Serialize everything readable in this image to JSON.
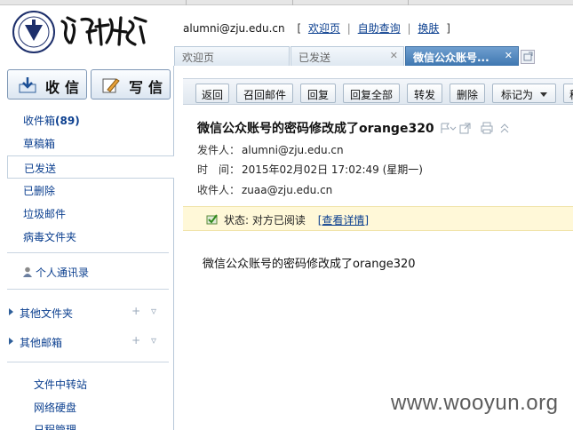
{
  "account": {
    "email": "alumni@zju.edu.cn",
    "links": [
      "欢迎页",
      "自助查询",
      "换肤"
    ]
  },
  "tabs": [
    {
      "label": "欢迎页",
      "closable": false
    },
    {
      "label": "已发送",
      "closable": true
    },
    {
      "label": "微信公众账号...",
      "closable": true,
      "active": true
    }
  ],
  "sidebar": {
    "receive_label": "收信",
    "compose_label": "写信",
    "folders": [
      {
        "label": "收件箱",
        "count": "(89)"
      },
      {
        "label": "草稿箱"
      },
      {
        "label": "已发送",
        "selected": true
      },
      {
        "label": "已删除"
      },
      {
        "label": "垃圾邮件"
      },
      {
        "label": "病毒文件夹"
      }
    ],
    "contacts_label": "个人通讯录",
    "groups": [
      {
        "label": "其他文件夹",
        "tools": "+ ▿"
      },
      {
        "label": "其他邮箱",
        "tools": "+ ▿"
      }
    ],
    "extras": [
      "文件中转站",
      "网络硬盘",
      "日程管理"
    ]
  },
  "toolbar": {
    "buttons": [
      "返回",
      "召回邮件",
      "回复",
      "回复全部",
      "转发",
      "删除",
      "标记为",
      "移"
    ]
  },
  "message": {
    "subject": "微信公众账号的密码修改成了orange320",
    "from_label": "发件人：",
    "from": "alumni@zju.edu.cn",
    "time_label": "时　间：",
    "time": "2015年02月02日 17:02:49 (星期一)",
    "to_label": "收件人：",
    "to": "zuaa@zju.edu.cn",
    "status_text": "状态: 对方已阅读",
    "status_link": "[查看详情]",
    "body": "微信公众账号的密码修改成了orange320"
  },
  "watermark": "www.wooyun.org",
  "colors": {
    "link": "#0b3f8f",
    "active_tab": "#4a80b8",
    "status_bg": "#fff8d8"
  }
}
